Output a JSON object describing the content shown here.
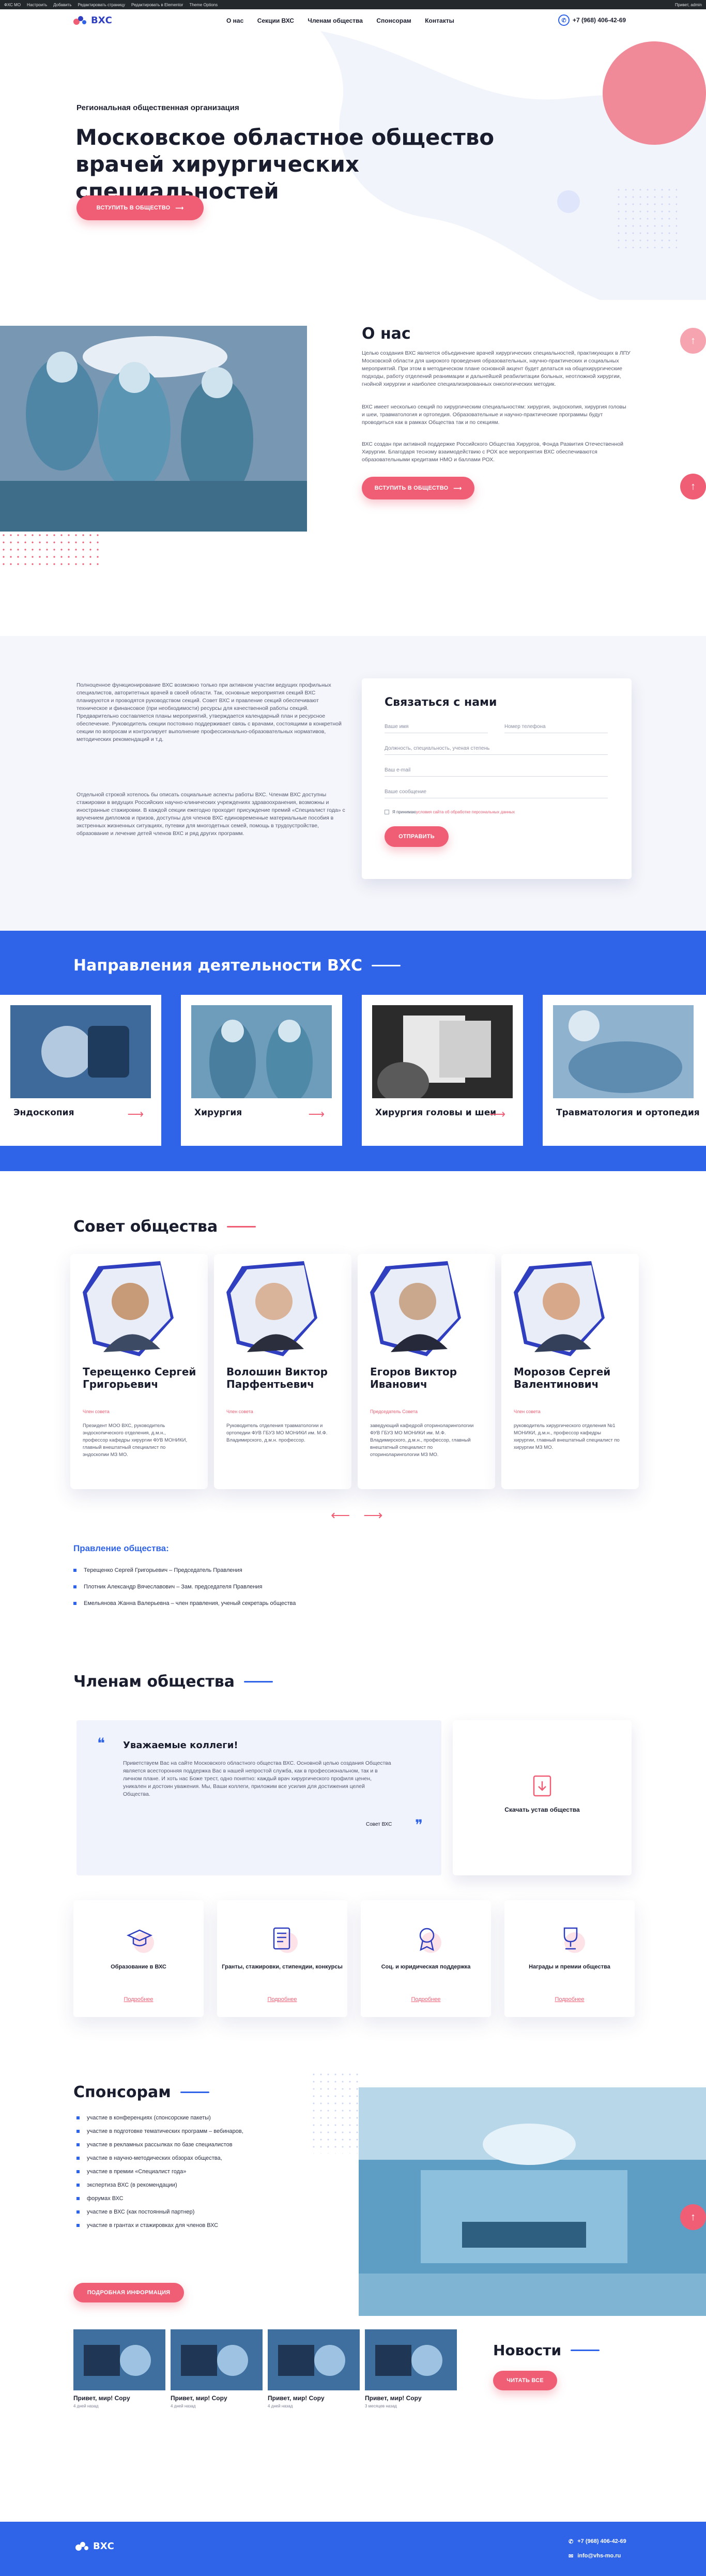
{
  "wpbar": {
    "items": [
      "ФХС МО",
      "Настроить",
      "Добавить",
      "Редактировать страницу",
      "Редактировать в Elementor",
      "Theme Options"
    ],
    "right": "Привет, admin"
  },
  "header": {
    "logo": "ВХС",
    "nav": [
      "О нас",
      "Секции ВХС",
      "Членам общества",
      "Спонсорам",
      "Контакты"
    ],
    "phone": "+7 (968) 406-42-69"
  },
  "hero": {
    "kicker": "Региональная общественная организация",
    "title": "Московское областное общество врачей хирургических специальностей",
    "button": "ВСТУПИТЬ В ОБЩЕСТВО",
    "arrow": "⟶"
  },
  "about": {
    "title": "О нас",
    "p1": "Целью создания ВХС является объединение врачей хирургических специальностей, практикующих в ЛПУ Московской области для широкого проведения образовательных, научно-практических и социальных мероприятий. При этом в методическом плане основной акцент будет делаться на общехирургические подходы, работу отделений реанимации и дальнейшей реабилитации больных, неотложной хирургии, гнойной хирургии и наиболее специализированных онкологических методик.",
    "p2": "ВХС имеет несколько секций по хирургическим специальностям: хирургия, эндоскопия, хирургия головы и шеи, травматология и ортопедия. Образовательные и научно-практические программы будут проводиться как в рамках Общества так и по секциям.",
    "p3": "ВХС создан при активной поддержке Российского Общества Хирургов, Фонда Развития Отечественной Хирургии. Благодаря тесному взаимодействию с РОХ все мероприятия ВХС обеспечиваются образовательными кредитами НМО и баллами РОХ.",
    "button": "ВСТУПИТЬ В ОБЩЕСТВО",
    "arrow": "⟶"
  },
  "info": {
    "p1": "Полноценное функционирование ВХС возможно только при активном участии ведущих профильных специалистов, авторитетных врачей в своей области. Так, основные мероприятия секций ВХС планируются и проводятся руководством секций. Совет ВХС и правление секций обеспечивают техническое и финансовое (при необходимости) ресурсы для качественной работы секций. Предварительно составляется планы мероприятий, утверждается календарный план и ресурсное обеспечение. Руководитель секции постоянно поддерживает связь с врачами, состоящими в конкретной секции по вопросам и контролирует выполнение профессионально-образовательных нормативов, методических рекомендаций и т.д.",
    "p2": "Отдельной строкой хотелось бы описать социальные аспекты работы ВХС. Членам ВХС доступны стажировки в ведущих Российских научно-клинических учреждениях здравоохранения, возможны и иностранные стажировки. В каждой секции ежегодно проходит присуждение премий «Специалист года» с вручением дипломов и призов, доступны для членов ВХС единовременные материальные пособия в экстренных жизненных ситуациях, путевки для многодетных семей, помощь в трудоустройстве, образование и лечение детей членов ВХС и ряд других программ."
  },
  "contact": {
    "title": "Связаться с нами",
    "name": "Ваше имя",
    "phone": "Номер телефона",
    "spec": "Должность, специальность, ученая степень",
    "email": "Ваш e-mail",
    "msg": "Ваше сообщение",
    "consent_prefix": "Я принимаю ",
    "consent_link": "условия сайта об обработке персональных данных",
    "button": "ОТПРАВИТЬ"
  },
  "directions": {
    "title": "Направления деятельности ВХС",
    "items": [
      {
        "label": "Эндоскопия"
      },
      {
        "label": "Хирургия"
      },
      {
        "label": "Хирургия головы и шеи"
      },
      {
        "label": "Травматология и ортопедия"
      }
    ],
    "arrow": "⟶"
  },
  "council": {
    "title": "Совет общества",
    "members": [
      {
        "name": "Терещенко Сергей Григорьевич",
        "role": "Член совета",
        "desc": "Президент МОО ВХС, руководитель эндоскопического отделения, д.м.н., профессор кафедры хирургии ФУВ МОНИКИ, главный внештатный специалист по эндоскопии МЗ МО."
      },
      {
        "name": "Волошин Виктор Парфентьевич",
        "role": "Член совета",
        "desc": "Руководитель отделения травматологии и ортопедии ФУВ ГБУЗ МО МОНИКИ им. М.Ф. Владимирского, д.м.н. профессор."
      },
      {
        "name": "Егоров Виктор Иванович",
        "role": "Председатель Совета",
        "desc": "заведующий кафедрой оториноларингологии ФУВ ГБУЗ МО МОНИКИ им. М.Ф. Владимирского, д.м.н., профессор, главный внештатный специалист по оториноларингологии МЗ МО."
      },
      {
        "name": "Морозов Сергей Валентинович",
        "role": "Член совета",
        "desc": "руководитель хирургического отделения №1 МОНИКИ, д.м.н., профессор кафедры хирургии, главный внештатный специалист по хирургии МЗ МО."
      }
    ],
    "prev": "⟵",
    "next": "⟶"
  },
  "board": {
    "title": "Правление общества:",
    "items": [
      "Терещенко Сергей Григорьевич – Председатель Правления",
      "Плотник Александр Вячеславович – Зам. председателя Правления",
      "Емельянова Жанна Валерьевна – член правления, ученый секретарь общества"
    ]
  },
  "members_section": {
    "title": "Членам общества",
    "letter_title": "Уважаемые коллеги!",
    "letter_text": "Приветствуем Вас на сайте Московского областного общества ВХС. Основной целью создания Общества является всесторонняя поддержка Вас в нашей непростой служба, как в профессиональном, так и в личном плане. И хоть нас Боже трест, одно понятно: каждый врач хирургического профиля ценен, уникален и достоин уважения. Мы, Ваши коллеги, приложим все усилия для достижения целей Общества.",
    "letter_sign": "Совет ВХС",
    "quote_open": "❝",
    "quote_close": "❞",
    "charter": "Скачать устав общества",
    "services": [
      {
        "title": "Образование в ВХС",
        "link": "Подробнее",
        "icon": "graduation-cap-icon"
      },
      {
        "title": "Гранты, стажировки, стипендии, конкурсы",
        "link": "Подробнее",
        "icon": "checklist-icon"
      },
      {
        "title": "Соц. и юридическая поддержка",
        "link": "Подробнее",
        "icon": "award-icon"
      },
      {
        "title": "Награды и премии общества",
        "link": "Подробнее",
        "icon": "trophy-icon"
      }
    ]
  },
  "sponsors": {
    "title": "Спонсорам",
    "items": [
      "участие в конференциях (спонсорские пакеты)",
      "участие в подготовке тематических программ – вебинаров,",
      "участие в рекламных рассылках по базе специалистов",
      "участие в научно-методических обзорах общества,",
      "участие в премии «Специалист года»",
      "экспертиза ВХС (в рекомендации)",
      "форумах ВХС",
      "участие в ВХС (как постоянный партнер)",
      "участие в грантах и стажировках для членов ВХС"
    ],
    "button": "ПОДРОБНАЯ ИНФОРМАЦИЯ"
  },
  "news": {
    "title": "Новости",
    "button": "ЧИТАТЬ ВСЕ",
    "items": [
      {
        "title": "Привет, мир! Copy",
        "date": "4 дней назад"
      },
      {
        "title": "Привет, мир! Copy",
        "date": "4 дней назад"
      },
      {
        "title": "Привет, мир! Copy",
        "date": "4 дней назад"
      },
      {
        "title": "Привет, мир! Copy",
        "date": "3 месяцев назад"
      }
    ]
  },
  "footer": {
    "logo": "ВХС",
    "phone": "+7 (968) 406-42-69",
    "email": "info@vhs-mo.ru"
  },
  "colors": {
    "accent_pink": "#ef5e74",
    "accent_blue": "#2f63e8",
    "brand_blue": "#2f3fbf"
  }
}
